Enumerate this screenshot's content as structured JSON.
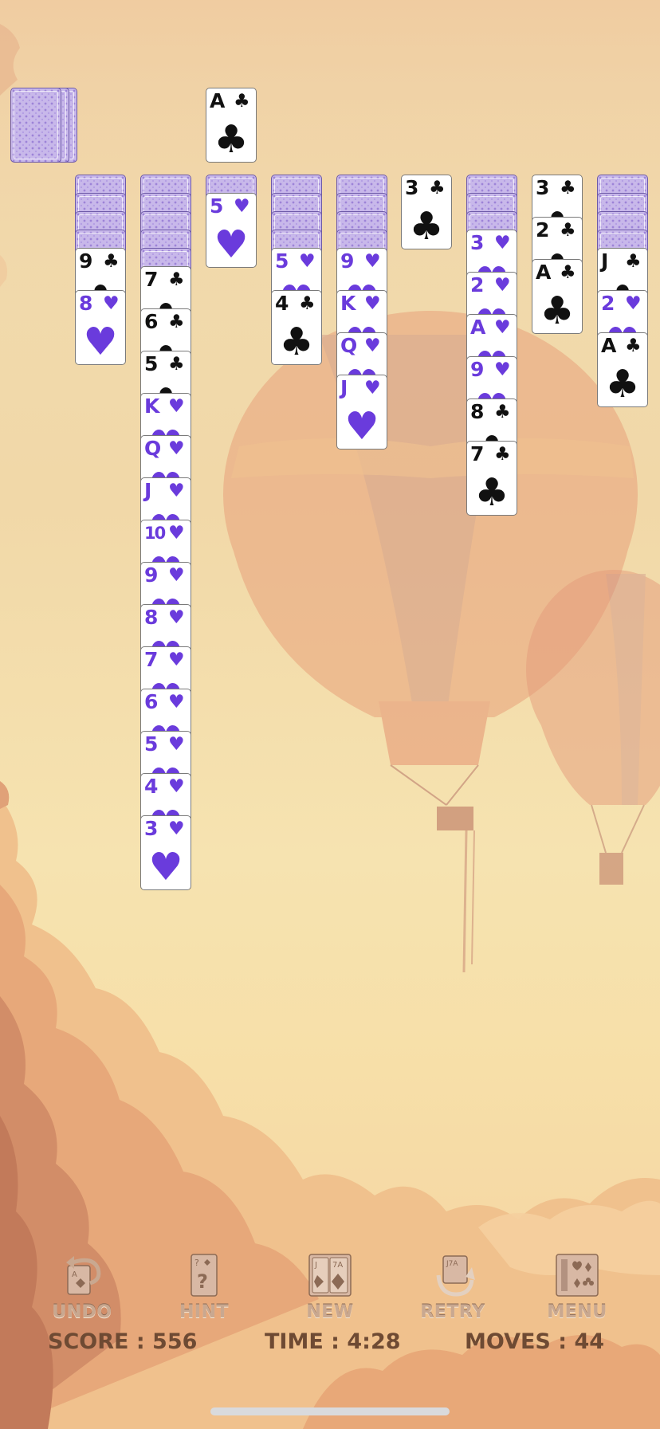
{
  "theme": {
    "card_back": "#c8b8ea",
    "red_suit": "#6a3bdc",
    "black_suit": "#111111"
  },
  "stock": {
    "remaining_stacks": 3
  },
  "foundation": [
    {
      "rank": "A",
      "suit": "clubs"
    }
  ],
  "tableau": [
    {
      "face_down": 4,
      "face_up": [
        {
          "rank": "9",
          "suit": "clubs"
        },
        {
          "rank": "8",
          "suit": "hearts"
        }
      ]
    },
    {
      "face_down": 5,
      "face_up": [
        {
          "rank": "7",
          "suit": "clubs"
        },
        {
          "rank": "6",
          "suit": "clubs"
        },
        {
          "rank": "5",
          "suit": "clubs"
        },
        {
          "rank": "K",
          "suit": "hearts"
        },
        {
          "rank": "Q",
          "suit": "hearts"
        },
        {
          "rank": "J",
          "suit": "hearts"
        },
        {
          "rank": "10",
          "suit": "hearts"
        },
        {
          "rank": "9",
          "suit": "hearts"
        },
        {
          "rank": "8",
          "suit": "hearts"
        },
        {
          "rank": "7",
          "suit": "hearts"
        },
        {
          "rank": "6",
          "suit": "hearts"
        },
        {
          "rank": "5",
          "suit": "hearts"
        },
        {
          "rank": "4",
          "suit": "hearts"
        },
        {
          "rank": "3",
          "suit": "hearts"
        }
      ]
    },
    {
      "face_down": 1,
      "face_up": [
        {
          "rank": "5",
          "suit": "hearts"
        }
      ]
    },
    {
      "face_down": 4,
      "face_up": [
        {
          "rank": "5",
          "suit": "hearts"
        },
        {
          "rank": "4",
          "suit": "clubs"
        }
      ]
    },
    {
      "face_down": 4,
      "face_up": [
        {
          "rank": "9",
          "suit": "hearts"
        },
        {
          "rank": "K",
          "suit": "hearts"
        },
        {
          "rank": "Q",
          "suit": "hearts"
        },
        {
          "rank": "J",
          "suit": "hearts"
        }
      ]
    },
    {
      "face_down": 0,
      "face_up": [
        {
          "rank": "3",
          "suit": "clubs"
        }
      ]
    },
    {
      "face_down": 3,
      "face_up": [
        {
          "rank": "3",
          "suit": "hearts"
        },
        {
          "rank": "2",
          "suit": "hearts"
        },
        {
          "rank": "A",
          "suit": "hearts"
        },
        {
          "rank": "9",
          "suit": "hearts"
        },
        {
          "rank": "8",
          "suit": "clubs"
        },
        {
          "rank": "7",
          "suit": "clubs"
        }
      ]
    },
    {
      "face_down": 0,
      "face_up": [
        {
          "rank": "3",
          "suit": "clubs"
        },
        {
          "rank": "2",
          "suit": "clubs"
        },
        {
          "rank": "A",
          "suit": "clubs"
        }
      ]
    },
    {
      "face_down": 4,
      "face_up": [
        {
          "rank": "J",
          "suit": "clubs"
        },
        {
          "rank": "2",
          "suit": "hearts"
        },
        {
          "rank": "A",
          "suit": "clubs"
        }
      ]
    }
  ],
  "toolbar": {
    "undo": {
      "label": "UNDO",
      "icon": "undo-icon"
    },
    "hint": {
      "label": "HINT",
      "icon": "hint-icon"
    },
    "new": {
      "label": "NEW",
      "icon": "new-game-icon"
    },
    "retry": {
      "label": "RETRY",
      "icon": "retry-icon"
    },
    "menu": {
      "label": "MENU",
      "icon": "menu-icon"
    }
  },
  "stats": {
    "score": "SCORE : 556",
    "time": "TIME : 4:28",
    "moves": "MOVES : 44"
  }
}
